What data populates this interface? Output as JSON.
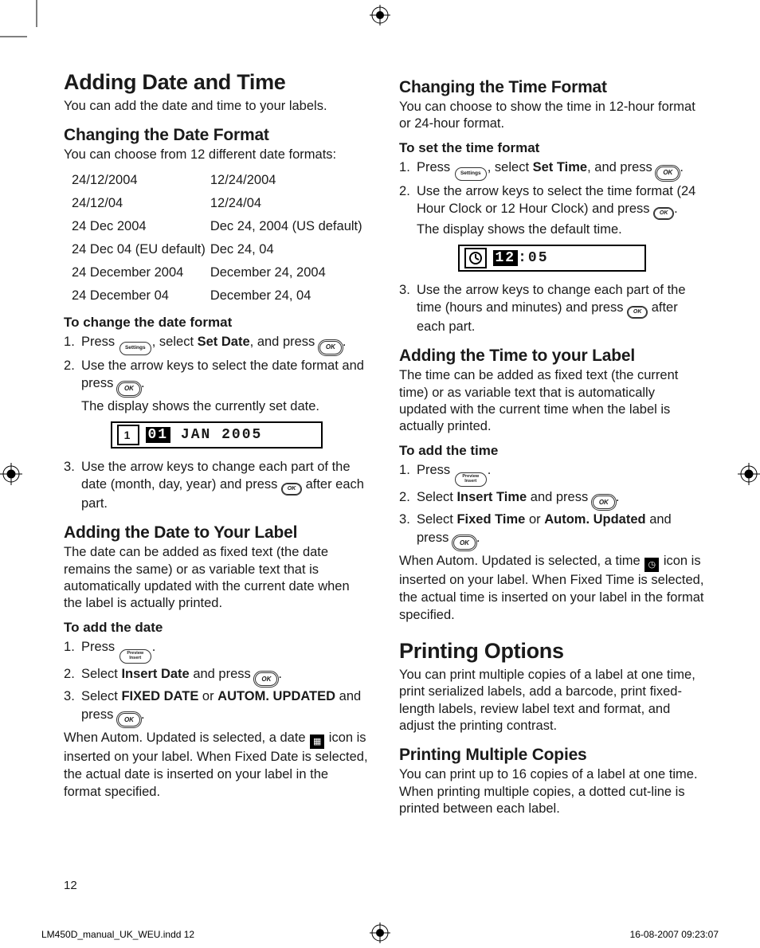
{
  "page_number": "12",
  "footer": {
    "file": "LM450D_manual_UK_WEU.indd   12",
    "timestamp": "16-08-2007   09:23:07"
  },
  "buttons": {
    "settings": "Settings",
    "ok": "OK",
    "preview_l1": "Preview",
    "preview_l2": "Insert"
  },
  "left": {
    "h1": "Adding Date and Time",
    "intro": "You can add the date and time to your labels.",
    "h2a": "Changing the Date Format",
    "p2a": "You can choose from 12 different date formats:",
    "formats": [
      [
        "24/12/2004",
        "12/24/2004"
      ],
      [
        "24/12/04",
        "12/24/04"
      ],
      [
        "24 Dec 2004",
        "Dec 24, 2004 (US default)"
      ],
      [
        "24 Dec 04 (EU default)",
        "Dec 24, 04"
      ],
      [
        "24 December 2004",
        "December 24, 2004"
      ],
      [
        "24 December 04",
        "December 24, 04"
      ]
    ],
    "sub1": "To change the date format",
    "s1_li1a": "Press ",
    "s1_li1b": ", select ",
    "s1_li1_bold": "Set Date",
    "s1_li1c": ", and press ",
    "s1_li1d": ".",
    "s1_li2a": "Use the arrow keys to select the date format and press ",
    "s1_li2b": ".",
    "s1_li2c": "The display shows the currently set date.",
    "lcd1_n": "1",
    "lcd1_sel": "01",
    "lcd1_rest": "JAN 2005",
    "s1_li3a": "Use the arrow keys to change each part of the date (month, day, year) and press ",
    "s1_li3b": " after each part.",
    "h2b": "Adding the Date to Your Label",
    "p2b": "The date can be added as fixed text (the date remains the same) or as variable text that is automatically updated with the current date when the label is actually printed.",
    "sub2": "To add the date",
    "s2_li1a": "Press ",
    "s2_li1b": ".",
    "s2_li2a": "Select ",
    "s2_li2_bold": "Insert Date",
    "s2_li2b": " and press ",
    "s2_li2c": ".",
    "s2_li3a": "Select ",
    "s2_li3_b1": "FIXED DATE",
    "s2_li3_or": " or ",
    "s2_li3_b2": "AUTOM. UPDATED",
    "s2_li3b": " and press ",
    "s2_li3c": ".",
    "p2c1": "When Autom. Updated is selected, a date ",
    "p2c2": " icon is inserted on your label. When Fixed Date is selected, the actual date is inserted on your label in the format specified."
  },
  "right": {
    "h2a": "Changing the Time Format",
    "p1": "You can choose to show the time in 12-hour format or 24-hour format.",
    "sub1": "To set the time format",
    "r1_li1a": "Press ",
    "r1_li1b": ", select ",
    "r1_li1_bold": "Set Time",
    "r1_li1c": ", and press ",
    "r1_li1d": ".",
    "r1_li2a": "Use the arrow keys to select the time format (24 Hour Clock or 12 Hour Clock) and press ",
    "r1_li2b": ".",
    "r1_li2c": "The display shows the default time.",
    "lcd2_sel": "12",
    "lcd2_rest": ":05",
    "r1_li3a": "Use the arrow keys to change each part of the time (hours and minutes) and press ",
    "r1_li3b": " after each part.",
    "h2b": "Adding the Time to your Label",
    "p2": "The time can be added as fixed text (the current time) or as variable text that is automatically updated with the current time when the label is actually printed.",
    "sub2": "To add the time",
    "r2_li1a": "Press ",
    "r2_li1b": ".",
    "r2_li2a": "Select ",
    "r2_li2_bold": "Insert Time",
    "r2_li2b": " and press ",
    "r2_li2c": ".",
    "r2_li3a": "Select ",
    "r2_li3_b1": "Fixed Time",
    "r2_li3_or": " or ",
    "r2_li3_b2": "Autom. Updated",
    "r2_li3b": " and press ",
    "r2_li3c": ".",
    "p3a": "When Autom. Updated is selected, a time ",
    "p3b": " icon is inserted on your label. When Fixed Time is selected, the actual time is inserted on your label in the format specified.",
    "h1b": "Printing Options",
    "p4": "You can print multiple copies of a label at one time, print serialized labels, add a barcode, print fixed-length labels, review label text and format, and adjust the printing contrast.",
    "h2c": "Printing Multiple Copies",
    "p5": "You can print up to 16 copies of a label at one time. When printing multiple copies, a dotted cut-line is printed between each label."
  }
}
